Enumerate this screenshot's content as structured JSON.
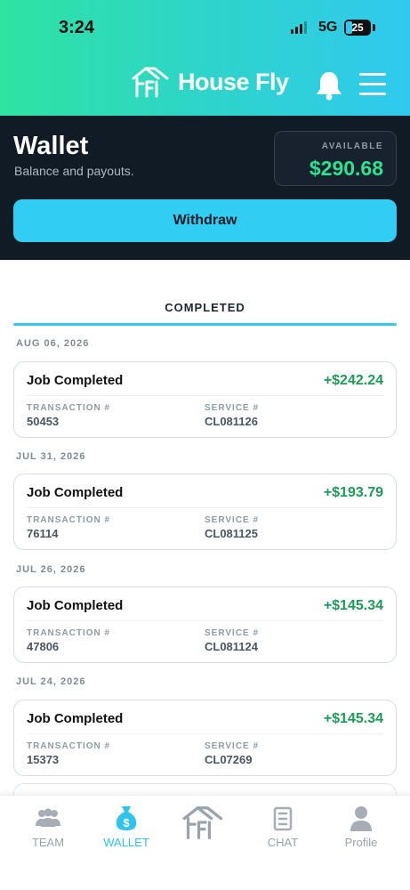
{
  "status_bar": {
    "time": "3:24",
    "network": "5G",
    "battery": "25",
    "battery_level_percent": 25
  },
  "app_bar": {
    "brand": "House Fly",
    "icons": [
      "house-fly-logo-icon",
      "bell-icon",
      "menu-icon"
    ]
  },
  "wallet": {
    "title": "Wallet",
    "subtitle": "Balance and payouts.",
    "available_label": "AVAILABLE",
    "available_amount": "$290.68",
    "withdraw_label": "Withdraw"
  },
  "tabs": {
    "active": "COMPLETED"
  },
  "transactions": [
    {
      "date": "AUG 06, 2026",
      "title": "Job Completed",
      "amount": "+$242.24",
      "transaction_label": "TRANSACTION #",
      "transaction": "50453",
      "service_label": "SERVICE #",
      "service": "CL081126"
    },
    {
      "date": "JUL 31, 2026",
      "title": "Job Completed",
      "amount": "+$193.79",
      "transaction_label": "TRANSACTION #",
      "transaction": "76114",
      "service_label": "SERVICE #",
      "service": "CL081125"
    },
    {
      "date": "JUL 26, 2026",
      "title": "Job Completed",
      "amount": "+$145.34",
      "transaction_label": "TRANSACTION #",
      "transaction": "47806",
      "service_label": "SERVICE #",
      "service": "CL081124"
    },
    {
      "date": "JUL 24, 2026",
      "title": "Job Completed",
      "amount": "+$145.34",
      "transaction_label": "TRANSACTION #",
      "transaction": "15373",
      "service_label": "SERVICE #",
      "service": "CL07269"
    }
  ],
  "bottom_nav": [
    {
      "label": "TEAM",
      "icon": "team-icon",
      "active": false
    },
    {
      "label": "WALLET",
      "icon": "money-bag-icon",
      "active": true
    },
    {
      "label": "",
      "icon": "house-fly-logo-icon",
      "active": false
    },
    {
      "label": "CHAT",
      "icon": "chat-icon",
      "active": false
    },
    {
      "label": "Profile",
      "icon": "profile-icon",
      "active": false
    }
  ],
  "colors": {
    "gradient_start": "#2ee3a2",
    "gradient_end": "#30c9ef",
    "header_dark": "#101b26",
    "accent": "#32cdf2",
    "positive": "#1e9a57",
    "available_green": "#2ee38f"
  }
}
